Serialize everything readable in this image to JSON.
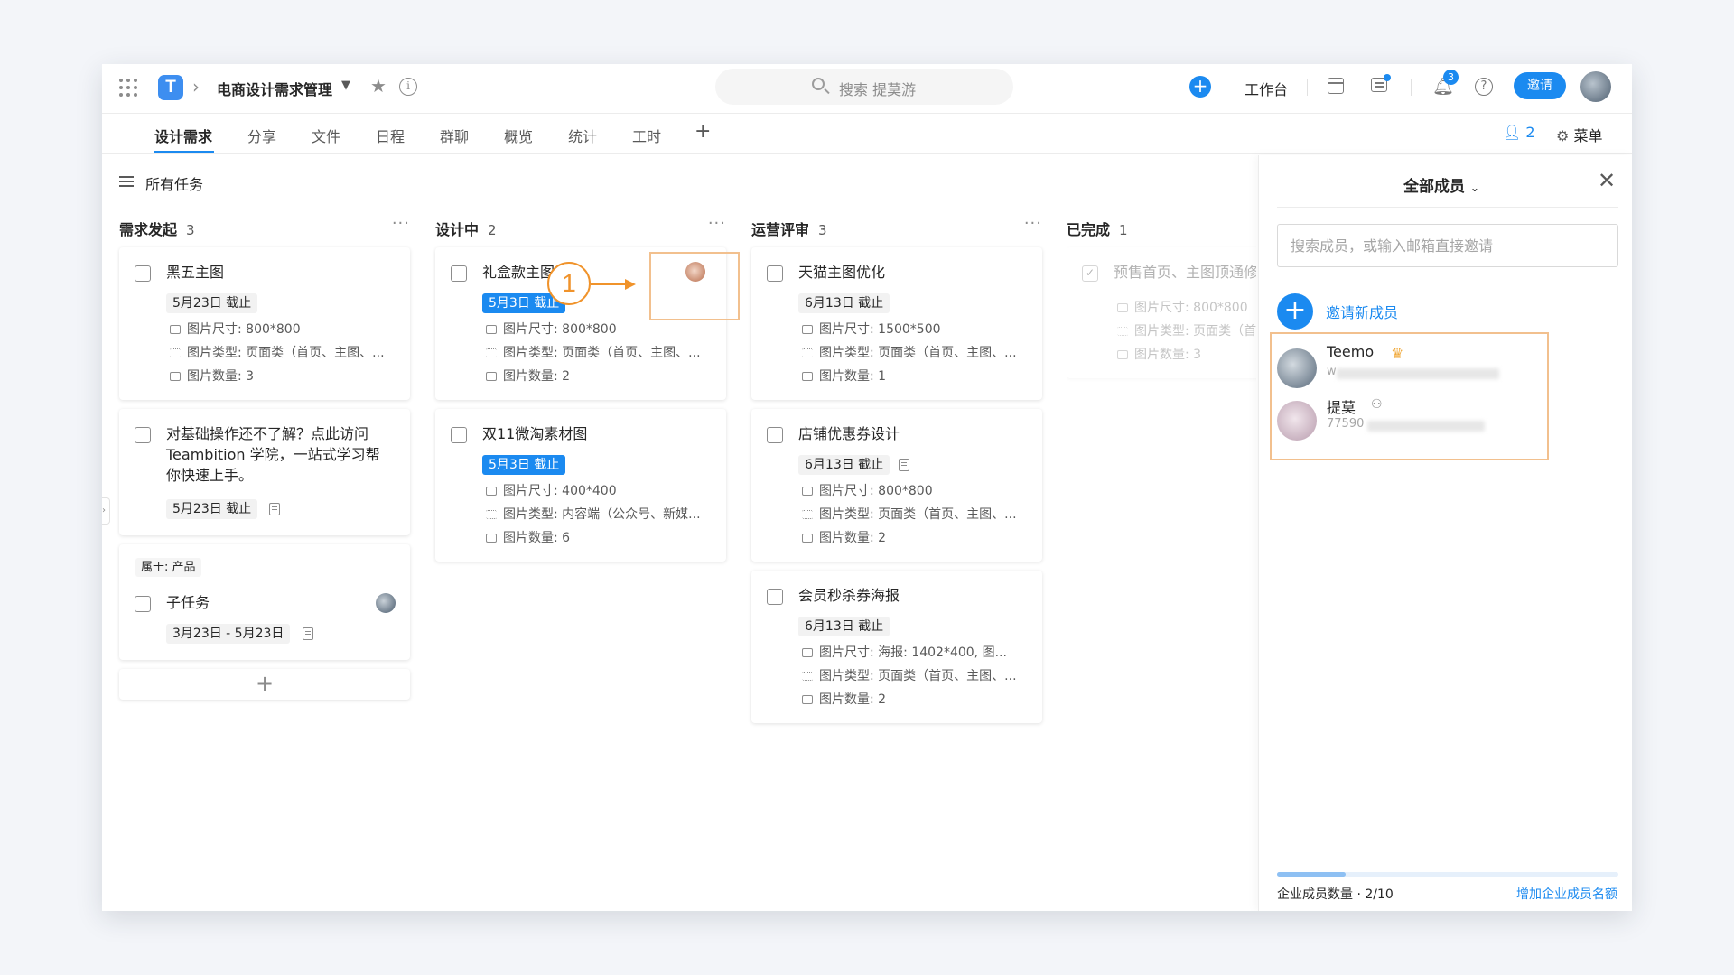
{
  "header": {
    "project_title": "电商设计需求管理",
    "search_placeholder": "搜索 提莫游",
    "workbench_label": "工作台",
    "notification_count": "3",
    "invite_label": "邀请"
  },
  "tabs": [
    {
      "label": "设计需求",
      "active": true
    },
    {
      "label": "分享"
    },
    {
      "label": "文件"
    },
    {
      "label": "日程"
    },
    {
      "label": "群聊"
    },
    {
      "label": "概览"
    },
    {
      "label": "统计"
    },
    {
      "label": "工时"
    }
  ],
  "toolbar": {
    "members_count": "2",
    "menu_label": "菜单",
    "all_tasks_label": "所有任务"
  },
  "columns": [
    {
      "title": "需求发起",
      "count": "3",
      "cards": [
        {
          "title": "黑五主图",
          "due": "5月23日 截止",
          "size": "图片尺寸: 800*800",
          "type": "图片类型: 页面类（首页、主图、...",
          "qty": "图片数量: 3"
        },
        {
          "title_lines": [
            "对基础操作还不了解？点此访问",
            "Teambition 学院，一站式学习帮",
            "你快速上手。"
          ],
          "due": "5月23日 截止"
        },
        {
          "belong": "属于: 产品",
          "title": "子任务",
          "due": "3月23日 - 5月23日"
        }
      ]
    },
    {
      "title": "设计中",
      "count": "2",
      "cards": [
        {
          "title": "礼盒款主图",
          "due": "5月3日 截止",
          "size": "图片尺寸: 800*800",
          "type": "图片类型: 页面类（首页、主图、...",
          "qty": "图片数量: 2"
        },
        {
          "title": "双11微淘素材图",
          "due": "5月3日 截止",
          "size": "图片尺寸: 400*400",
          "type": "图片类型: 内容端（公众号、新媒...",
          "qty": "图片数量: 6"
        }
      ]
    },
    {
      "title": "运营评审",
      "count": "3",
      "cards": [
        {
          "title": "天猫主图优化",
          "due": "6月13日 截止",
          "size": "图片尺寸: 1500*500",
          "type": "图片类型: 页面类（首页、主图、...",
          "qty": "图片数量: 1"
        },
        {
          "title": "店铺优惠券设计",
          "due": "6月13日 截止",
          "size": "图片尺寸: 800*800",
          "type": "图片类型: 页面类（首页、主图、...",
          "qty": "图片数量: 2"
        },
        {
          "title": "会员秒杀券海报",
          "due": "6月13日 截止",
          "size": "图片尺寸: 海报: 1402*400, 图...",
          "type": "图片类型: 页面类（首页、主图、...",
          "qty": "图片数量: 2"
        }
      ]
    },
    {
      "title": "已完成",
      "count": "1",
      "cards": [
        {
          "title": "预售首页、主图顶通修",
          "size": "图片尺寸: 800*800",
          "type": "图片类型: 页面类（首",
          "qty": "图片数量: 3"
        }
      ]
    }
  ],
  "annotation": {
    "number": "1"
  },
  "panel": {
    "title": "全部成员",
    "search_placeholder": "搜索成员，或输入邮箱直接邀请",
    "invite_label": "邀请新成员",
    "members": [
      {
        "name": "Teemo",
        "sub": "w"
      },
      {
        "name": "提莫",
        "sub": "77590"
      }
    ],
    "quota_text": "企业成员数量 · 2/10",
    "quota_fraction": 0.2,
    "quota_link": "增加企业成员名额"
  },
  "colors": {
    "accent": "#1b8af0",
    "annotation": "#f0932b",
    "highlight": "#f2c08e"
  }
}
